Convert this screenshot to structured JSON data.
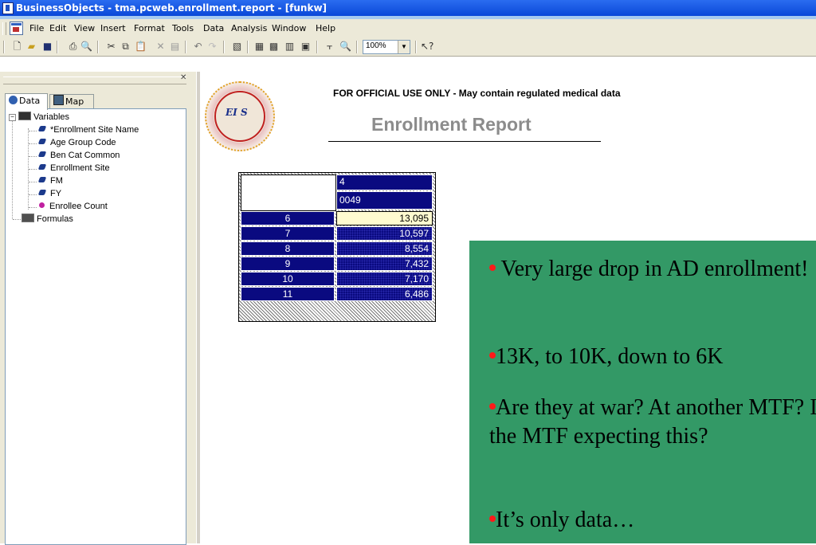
{
  "window": {
    "title": "BusinessObjects - tma.pcweb.enrollment.report - [funkw]"
  },
  "menu": {
    "items": [
      "File",
      "Edit",
      "View",
      "Insert",
      "Format",
      "Tools",
      "Data",
      "Analysis",
      "Window",
      "Help"
    ]
  },
  "toolbar": {
    "zoom": "100%",
    "icons": [
      "new-icon",
      "open-icon",
      "save-icon",
      "print-icon",
      "print-preview-icon",
      "cut-icon",
      "copy-icon",
      "paste-icon",
      "delete-icon",
      "clear-icon",
      "undo-icon",
      "redo-icon",
      "slice-dice-icon",
      "table-icon",
      "crosstab-icon",
      "chart-icon",
      "rank-icon",
      "zoom-icon",
      "help-icon"
    ]
  },
  "panel": {
    "tabs": [
      "Data",
      "Map"
    ],
    "tree": {
      "root": "Variables",
      "variables": [
        {
          "label": "*Enrollment Site Name",
          "kind": "dimension"
        },
        {
          "label": "Age Group Code",
          "kind": "dimension"
        },
        {
          "label": "Ben Cat Common",
          "kind": "dimension"
        },
        {
          "label": "Enrollment Site",
          "kind": "dimension"
        },
        {
          "label": "FM",
          "kind": "dimension"
        },
        {
          "label": "FY",
          "kind": "dimension"
        },
        {
          "label": "Enrollee Count",
          "kind": "measure"
        }
      ],
      "formulas": "Formulas"
    }
  },
  "report": {
    "notice": "FOR OFFICIAL USE ONLY - May contain regulated medical data",
    "title": "Enrollment Report",
    "crosstab": {
      "col_headers": [
        "4",
        "0049"
      ],
      "rows": [
        {
          "label": "6",
          "value": "13,095"
        },
        {
          "label": "7",
          "value": "10,597"
        },
        {
          "label": "8",
          "value": "8,554"
        },
        {
          "label": "9",
          "value": "7,432"
        },
        {
          "label": "10",
          "value": "7,170"
        },
        {
          "label": "11",
          "value": "6,486"
        }
      ]
    }
  },
  "callout": {
    "bullets": [
      " Very large drop in AD enrollment!",
      "13K, to 10K, down to 6K",
      "Are they at war?  At another MTF?  Is the MTF expecting this?",
      "It’s only data…"
    ]
  },
  "colors": {
    "callout_bg": "#339966",
    "crosstab_header": "#0a0a80",
    "titlebar": "#0a48d8"
  }
}
